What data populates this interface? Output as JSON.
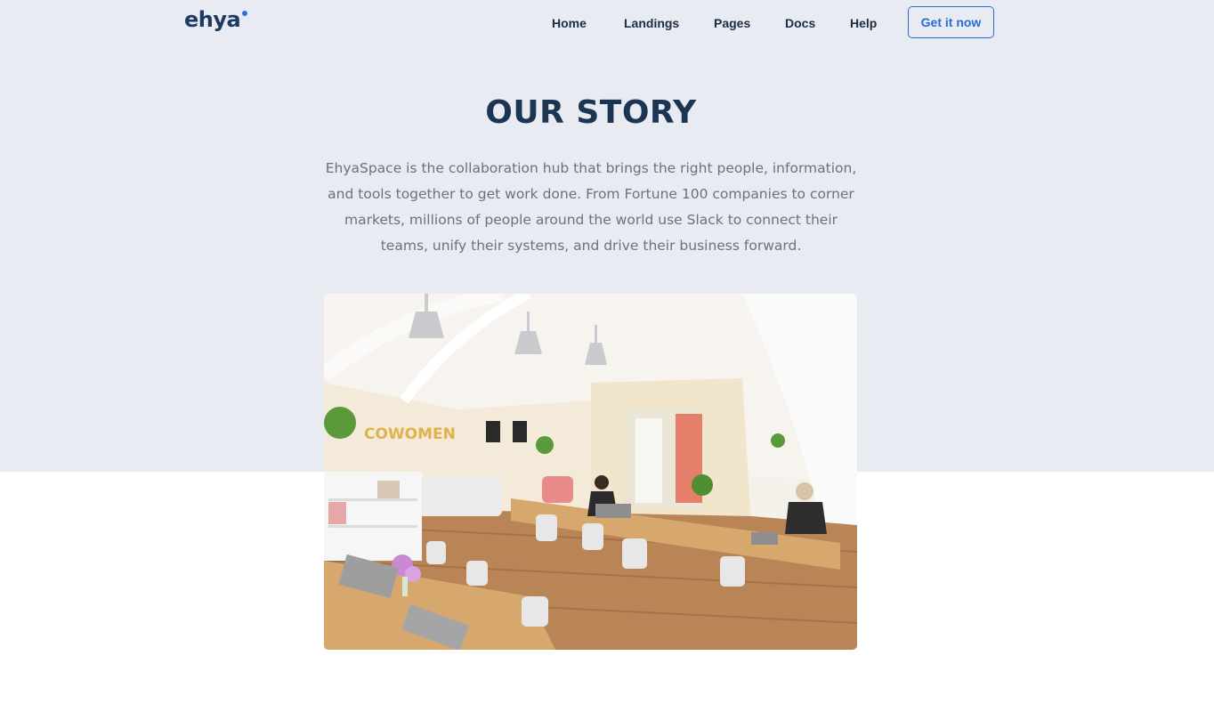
{
  "brand": {
    "logo_text": "ehya",
    "accent": "#2f6fe0"
  },
  "nav": {
    "items": [
      {
        "label": "Home"
      },
      {
        "label": "Landings"
      },
      {
        "label": "Pages"
      },
      {
        "label": "Docs"
      },
      {
        "label": "Help"
      }
    ],
    "cta_label": "Get it now"
  },
  "hero": {
    "title": "OUR STORY",
    "description": "EhyaSpace is the collaboration hub that brings the right people, information, and tools together to get work done. From Fortune 100 companies to corner markets, millions of people around the world use Slack to connect their teams, unify their systems, and drive their business forward."
  },
  "photo": {
    "wall_text": "COWOMEN"
  },
  "colors": {
    "hero_background": "#e8ebf2",
    "heading": "#1c3552",
    "body_text": "#6b7180",
    "button": "#2a6bd6"
  }
}
